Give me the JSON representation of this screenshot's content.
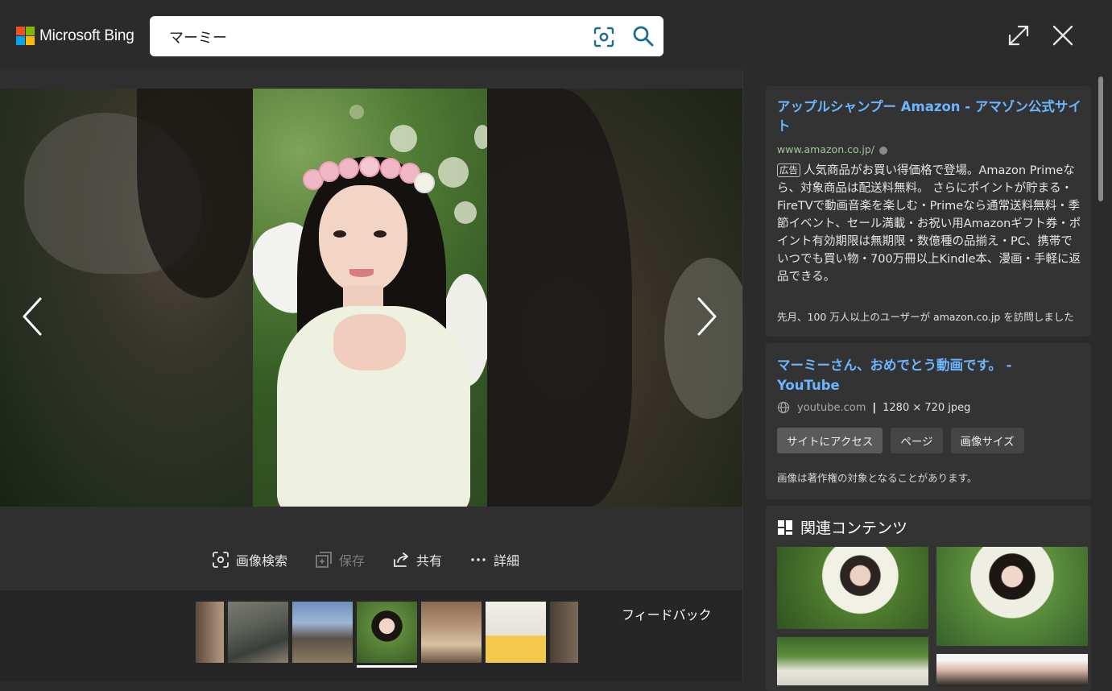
{
  "header": {
    "brand": "Microsoft Bing",
    "logo_colors": [
      "#f25022",
      "#7fba00",
      "#00a4ef",
      "#ffb900"
    ],
    "search_value": "マーミー",
    "icons": [
      "visual-search-icon",
      "search-icon",
      "expand-icon",
      "close-icon"
    ]
  },
  "viewer": {
    "actions": [
      {
        "label": "画像検索",
        "icon": "visual-search-icon",
        "enabled": true
      },
      {
        "label": "保存",
        "icon": "save-icon",
        "enabled": false
      },
      {
        "label": "共有",
        "icon": "share-icon",
        "enabled": true
      },
      {
        "label": "詳細",
        "icon": "more-icon",
        "enabled": true
      }
    ],
    "feedback": "フィードバック"
  },
  "ad": {
    "title": "アップルシャンプー Amazon - アマゾン公式サイト",
    "url": "www.amazon.co.jp/",
    "badge": "広告",
    "body": "人気商品がお買い得価格で登場。Amazon Primeなら、対象商品は配送料無料。 さらにポイントが貯まる・FireTVで動画音楽を楽しむ・Primeなら通常送料無料・季節イベント、セール満載・お祝い用Amazonギフト券・ポイント有効期限は無期限・数億種の品揃え・PC、携帯でいつでも買い物・700万冊以上Kindle本、漫画・手軽に返品できる。",
    "footer": "先月、100 万人以上のユーザーが amazon.co.jp を訪問しました"
  },
  "source": {
    "title": "マーミーさん、おめでとう動画です。 - YouTube",
    "domain": "youtube.com",
    "dimensions": "1280 × 720 jpeg",
    "buttons": [
      "サイトにアクセス",
      "ページ",
      "画像サイズ"
    ],
    "copyright": "画像は著作権の対象となることがあります。"
  },
  "related": {
    "heading": "関連コンテンツ"
  },
  "colors": {
    "link": "#6cb6ff",
    "url_green": "#a0c89a",
    "background": "#2b2b2b",
    "card": "#333333"
  }
}
